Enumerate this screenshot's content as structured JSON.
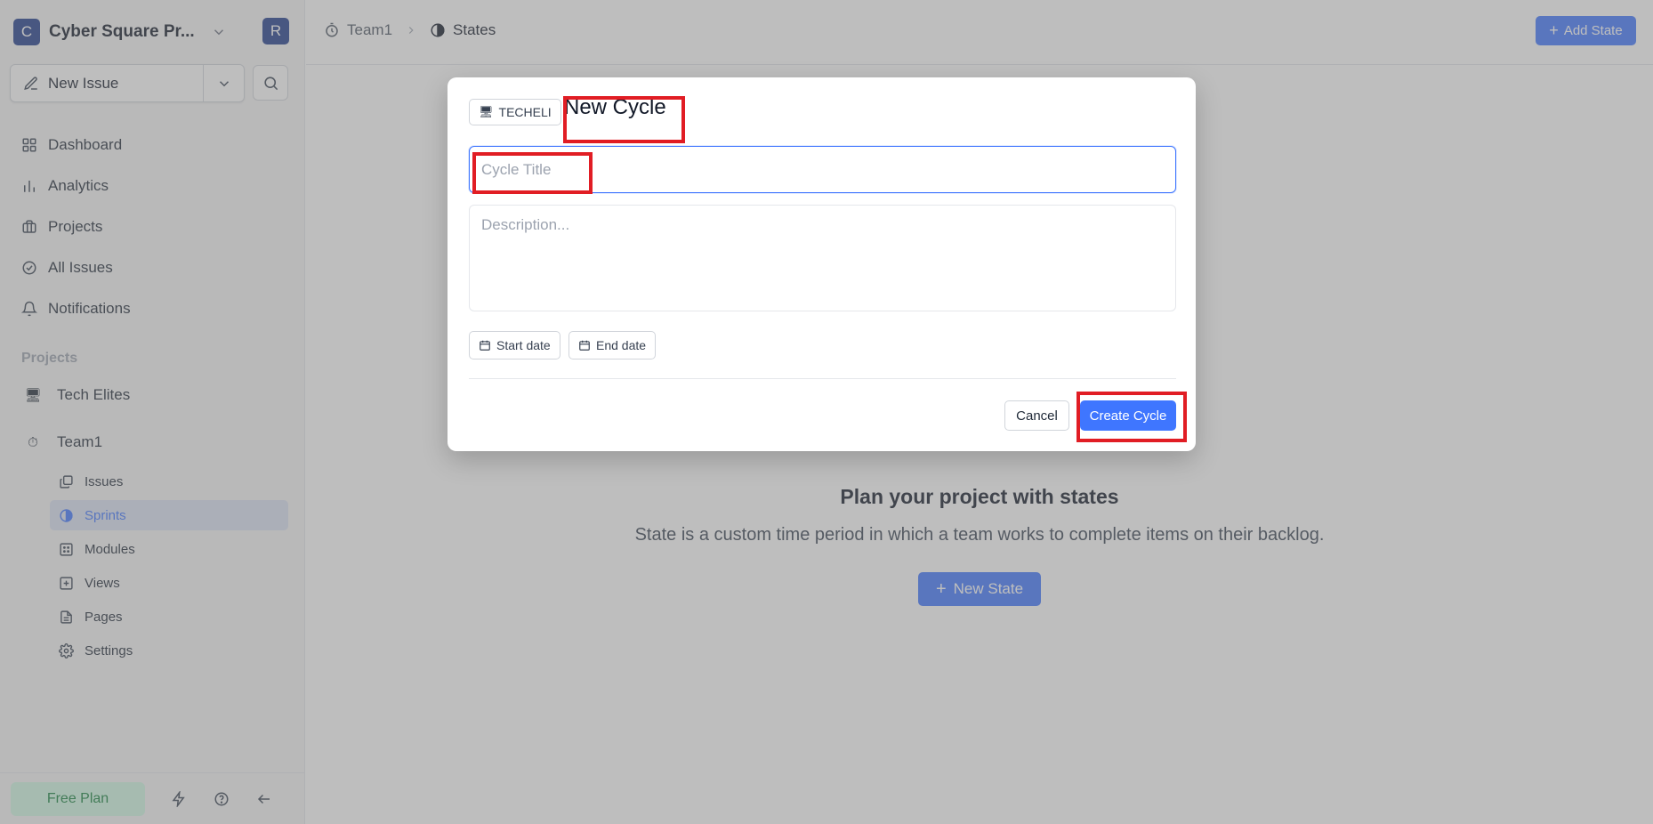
{
  "workspace": {
    "logo_letter": "C",
    "name": "Cyber Square Pr...",
    "avatar_letter": "R"
  },
  "sidebar": {
    "new_issue_label": "New Issue",
    "nav_items": [
      {
        "label": "Dashboard",
        "icon": "dashboard-grid-icon"
      },
      {
        "label": "Analytics",
        "icon": "bar-chart-icon"
      },
      {
        "label": "Projects",
        "icon": "briefcase-icon"
      },
      {
        "label": "All Issues",
        "icon": "check-circle-icon"
      },
      {
        "label": "Notifications",
        "icon": "bell-icon"
      }
    ],
    "projects_heading": "Projects",
    "projects": [
      {
        "label": "Tech Elites",
        "icon": "monitor-emoji-icon"
      },
      {
        "label": "Team1",
        "icon": "stopwatch-emoji-icon"
      }
    ],
    "team1_items": [
      {
        "label": "Issues",
        "icon": "layers-icon"
      },
      {
        "label": "Sprints",
        "icon": "contrast-circle-icon",
        "active": true
      },
      {
        "label": "Modules",
        "icon": "grid-dots-icon"
      },
      {
        "label": "Views",
        "icon": "sparkle-square-icon"
      },
      {
        "label": "Pages",
        "icon": "file-text-icon"
      },
      {
        "label": "Settings",
        "icon": "gear-icon"
      }
    ],
    "footer": {
      "plan_label": "Free Plan"
    }
  },
  "topbar": {
    "breadcrumb": [
      "Team1",
      "States"
    ],
    "add_state_label": "Add State"
  },
  "empty_state": {
    "title": "Plan your project with states",
    "description": "State is a custom time period in which a team works to complete items on their backlog.",
    "button_label": "New State"
  },
  "modal": {
    "project_chip": "TECHELI",
    "title": "New Cycle",
    "title_placeholder": "Cycle Title",
    "description_placeholder": "Description...",
    "start_date_label": "Start date",
    "end_date_label": "End date",
    "cancel_label": "Cancel",
    "create_label": "Create Cycle"
  },
  "colors": {
    "primary": "#3f76ff",
    "workspace": "#1e3a8a",
    "annotation": "#e11d24",
    "free_plan_bg": "#d1fae5"
  }
}
